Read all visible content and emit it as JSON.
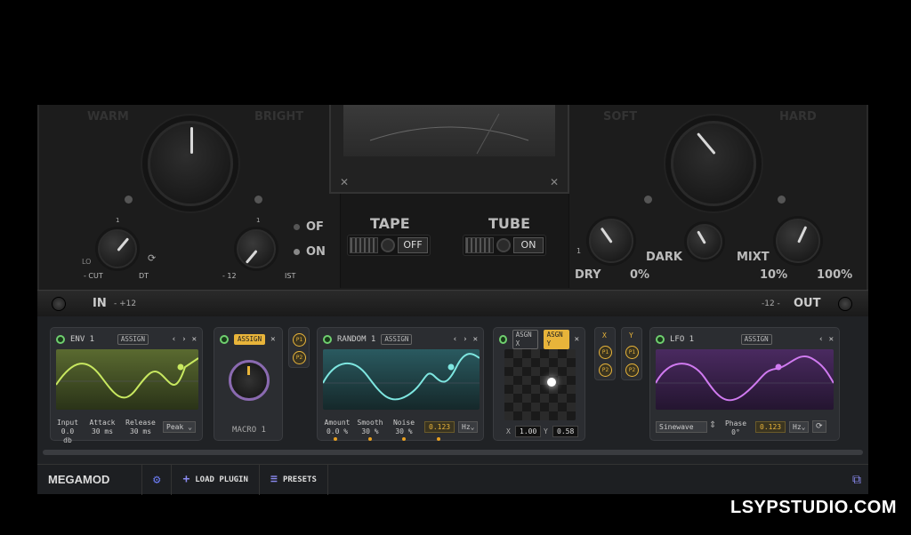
{
  "plugin": {
    "warm": "WARM",
    "bright": "BRIGHT",
    "soft": "SOFT",
    "hard": "HARD",
    "lo_cut_label": "LO",
    "lo_cut_sub": "- CUT",
    "hi_label": "- 12",
    "hi_label2": "DT",
    "hi2": "IST",
    "of": "OF",
    "on": "ON",
    "tape": "TAPE",
    "tape_btn": "OFF",
    "tube": "TUBE",
    "tube_btn": "ON",
    "dry": "DRY",
    "dry_val": "0%",
    "dark": "DARK",
    "mixt": "MIXT",
    "mix_min": "10%",
    "mix_max": "100%",
    "in_label": "IN",
    "in_val": "- +12",
    "out_label": "OUT",
    "out_val": "-12 -"
  },
  "env": {
    "title": "ENV 1",
    "assign": "ASSIGN",
    "params": [
      {
        "label": "Input",
        "value": "0.0 db"
      },
      {
        "label": "Attack",
        "value": "30 ms"
      },
      {
        "label": "Release",
        "value": "30 ms"
      }
    ],
    "mode": "Peak",
    "color": "#c8e860"
  },
  "macro": {
    "assign": "ASSIGN",
    "label": "MACRO 1"
  },
  "p_chips": {
    "p1": "P1",
    "p2": "P2"
  },
  "random": {
    "title": "RANDOM 1",
    "assign": "ASSIGN",
    "params": [
      {
        "label": "Amount",
        "value": "0.0 %"
      },
      {
        "label": "Smooth",
        "value": "30 %"
      },
      {
        "label": "Noise",
        "value": "30 %"
      }
    ],
    "rate": "0.123",
    "unit": "Hz",
    "color": "#7ee6e0"
  },
  "xy": {
    "assign_x": "ASGN X",
    "assign_y": "ASGN Y",
    "x_label": "X",
    "x_val": "1.00",
    "y_label": "Y",
    "y_val": "0.58"
  },
  "xy_chips": {
    "x": "X",
    "y": "Y",
    "p1": "P1",
    "p2": "P2"
  },
  "lfo": {
    "title": "LFO 1",
    "assign": "ASSIGN",
    "wave": "Sinewave",
    "phase_label": "Phase",
    "phase_val": "0°",
    "rate": "0.123",
    "unit": "Hz",
    "color": "#d07af0"
  },
  "bottom": {
    "logo": "MEGAMOD",
    "load": "LOAD PLUGIN",
    "presets": "PRESETS"
  },
  "watermark": "LSYPSTUDIO.COM"
}
